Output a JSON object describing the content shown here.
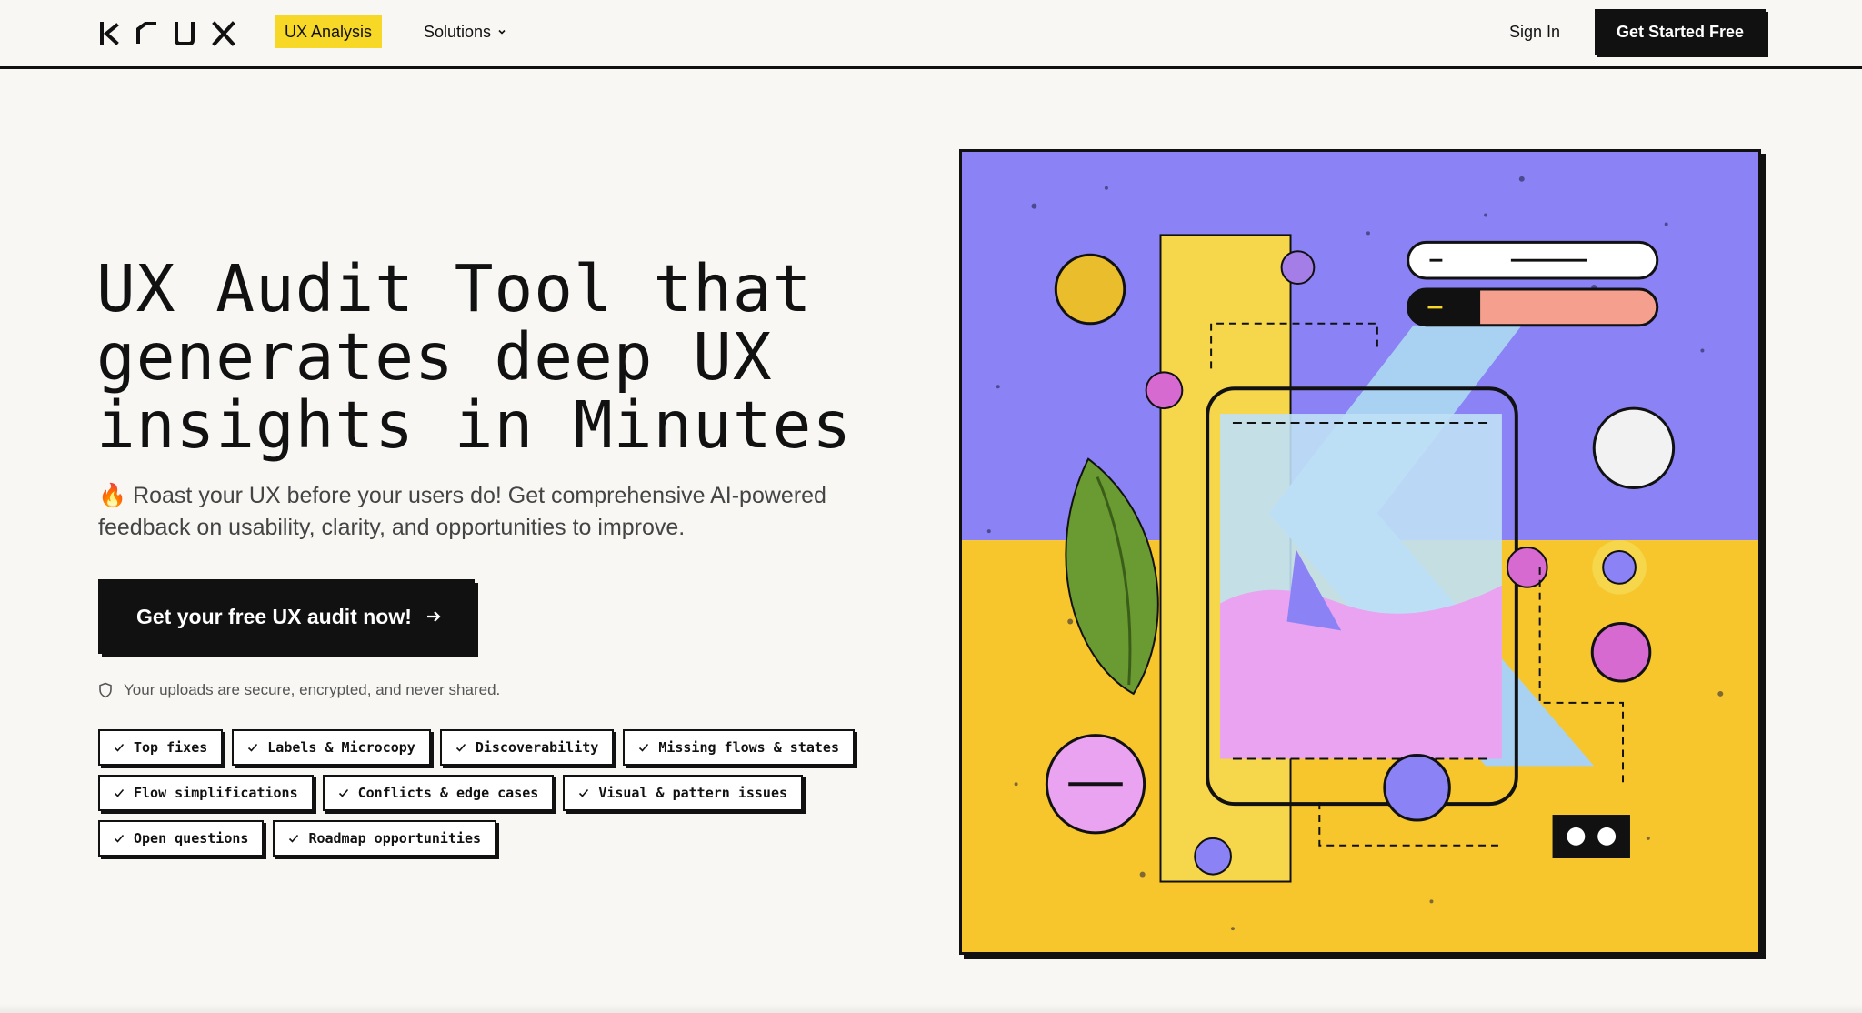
{
  "nav": {
    "logo_text": "KRUX",
    "badge_label": "UX Analysis",
    "solutions_label": "Solutions",
    "signin_label": "Sign In",
    "cta_label": "Get Started Free"
  },
  "hero": {
    "title_lines": [
      "UX Audit Tool that",
      "generates deep UX",
      "insights in Minutes"
    ],
    "subtitle": "🔥 Roast your UX before your users do! Get comprehensive AI-powered feedback on usability, clarity, and opportunities to improve.",
    "cta_label": "Get your free UX audit now!",
    "secure_note": "Your uploads are secure, encrypted, and never shared.",
    "tags": [
      [
        "Top fixes",
        "Labels & Microcopy",
        "Discoverability",
        "Missing flows & states"
      ],
      [
        "Flow simplifications",
        "Conflicts & edge cases",
        "Visual & pattern issues"
      ],
      [
        "Open questions",
        "Roadmap opportunities"
      ]
    ]
  },
  "colors": {
    "accent_yellow": "#f7d826",
    "violet": "#8a82f5",
    "art_yellow": "#f7c52c",
    "pink": "#e9a3f0",
    "sky": "#a9d2f2",
    "salmon": "#f5a08f",
    "ink": "#111111",
    "page_bg": "#f8f7f4"
  },
  "icons": [
    "chevron-down-icon",
    "arrow-right-icon",
    "shield-icon",
    "check-icon"
  ]
}
